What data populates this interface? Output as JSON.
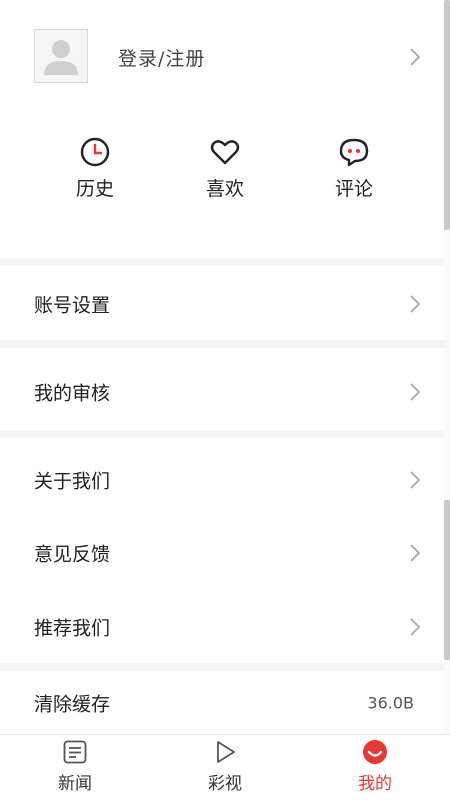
{
  "profile": {
    "login_label": "登录/注册"
  },
  "shortcuts": [
    {
      "label": "历史",
      "icon": "clock-icon"
    },
    {
      "label": "喜欢",
      "icon": "heart-icon"
    },
    {
      "label": "评论",
      "icon": "comment-icon"
    }
  ],
  "menu": {
    "account_settings": "账号设置",
    "my_review": "我的审核",
    "about_us": "关于我们",
    "feedback": "意见反馈",
    "recommend_us": "推荐我们",
    "clear_cache": "清除缓存",
    "cache_size": "36.0B"
  },
  "bottom_nav": [
    {
      "label": "新闻",
      "icon": "news-icon",
      "active": false
    },
    {
      "label": "彩视",
      "icon": "play-icon",
      "active": false
    },
    {
      "label": "我的",
      "icon": "me-icon",
      "active": true
    }
  ],
  "colors": {
    "accent": "#e53935",
    "icon_stroke": "#222222",
    "chevron": "#b0b0b0"
  }
}
